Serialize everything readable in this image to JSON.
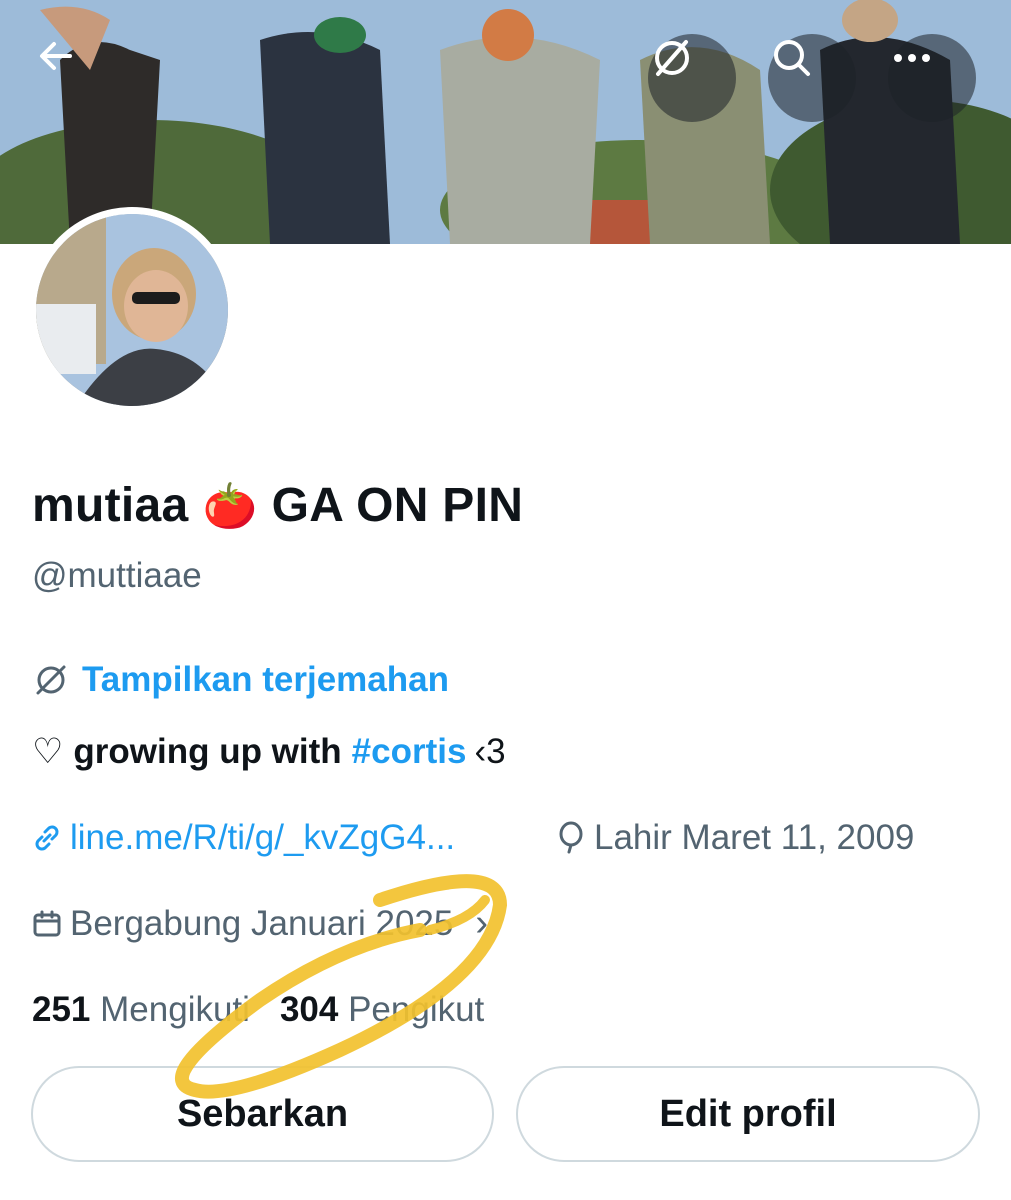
{
  "header": {
    "back_icon": "arrow-left-icon",
    "translate_icon": "translate-globe-icon",
    "search_icon": "search-icon",
    "more_icon": "more-horizontal-icon"
  },
  "profile": {
    "display_name_before": "mutiaa",
    "display_name_emoji": "🍅",
    "display_name_after": "GA ON PIN",
    "handle": "@muttiaae",
    "translate_label": "Tampilkan terjemahan",
    "bio_heart": "♡",
    "bio_text": "growing up with",
    "bio_hashtag": "#cortis",
    "bio_tail": "‹3",
    "link_text": "line.me/R/ti/g/_kvZgG4...",
    "birthday_text": "Lahir Maret 11, 2009",
    "joined_text": "Bergabung Januari 2025",
    "joined_chevron": "›",
    "following_count": "251",
    "following_label": "Mengikuti",
    "followers_count": "304",
    "followers_label": "Pengikut"
  },
  "actions": {
    "share_label": "Sebarkan",
    "edit_label": "Edit profil"
  },
  "colors": {
    "accent": "#1d9bf0",
    "muted": "#536471",
    "text": "#0f1419",
    "annotation": "#f2c12e"
  }
}
